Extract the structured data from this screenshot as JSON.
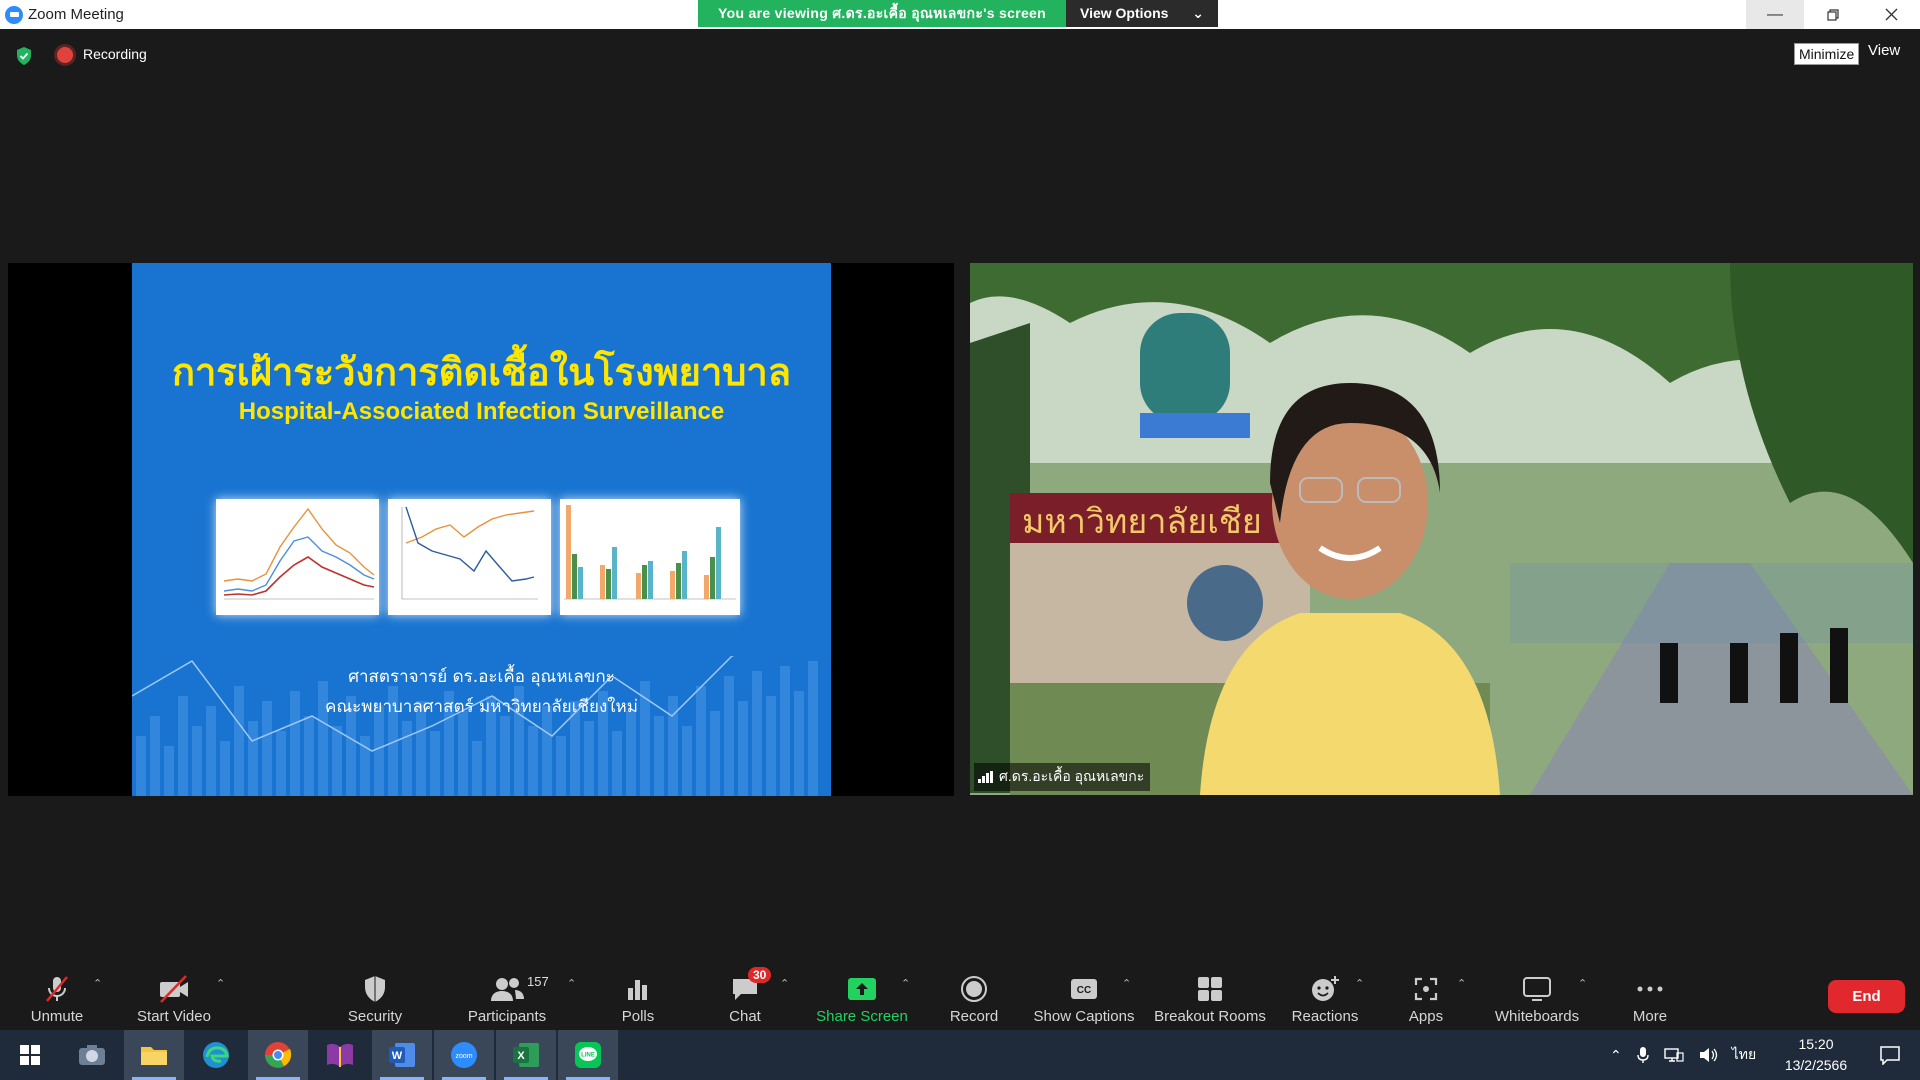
{
  "window": {
    "title": "Zoom Meeting",
    "viewing_banner": "You are viewing ศ.ดร.อะเคื้อ อุณหเลขกะ's screen",
    "view_options": "View Options"
  },
  "topbar": {
    "recording_label": "Recording",
    "minimize_tooltip": "Minimize",
    "view_label": "View"
  },
  "slide": {
    "title_thai": "การเฝ้าระวังการติดเชื้อในโรงพยาบาล",
    "title_english": "Hospital-Associated Infection Surveillance",
    "author": "ศาสตราจารย์ ดร.อะเคื้อ อุณหเลขกะ",
    "affiliation": "คณะพยาบาลศาสตร์ มหาวิทยาลัยเชียงใหม่"
  },
  "video": {
    "participant_name": "ศ.ดร.อะเคื้อ อุณหเลขกะ",
    "sign_text": "มหาวิทยาลัยเชีย"
  },
  "toolbar": {
    "unmute": "Unmute",
    "start_video": "Start Video",
    "security": "Security",
    "participants": "Participants",
    "participants_count": "157",
    "polls": "Polls",
    "chat": "Chat",
    "chat_badge": "30",
    "share_screen": "Share Screen",
    "record": "Record",
    "show_captions": "Show Captions",
    "breakout_rooms": "Breakout Rooms",
    "reactions": "Reactions",
    "apps": "Apps",
    "whiteboards": "Whiteboards",
    "more": "More",
    "end": "End"
  },
  "taskbar": {
    "language": "ไทย",
    "time": "15:20",
    "date": "13/2/2566"
  },
  "colors": {
    "zoom_blue": "#2d8cff",
    "banner_green": "#23b35f",
    "share_green": "#23d160",
    "end_red": "#e0282d",
    "slide_blue": "#1874d0",
    "slide_yellow": "#ffe600"
  }
}
